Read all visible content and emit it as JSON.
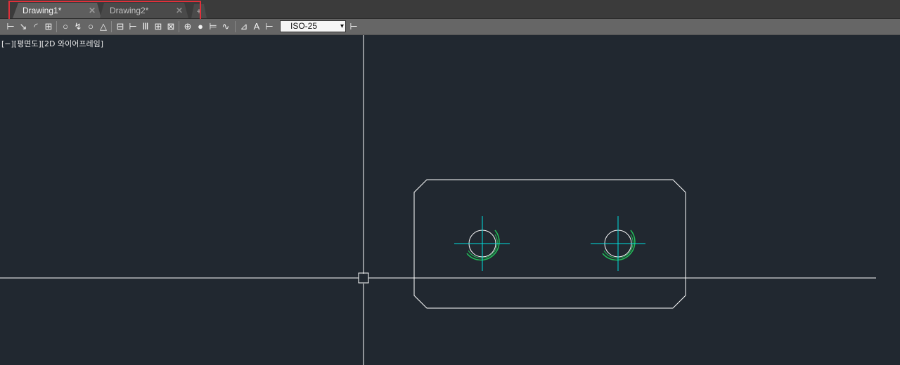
{
  "tabs": [
    {
      "label": "Drawing1*",
      "close": "✕",
      "active": true
    },
    {
      "label": "Drawing2*",
      "close": "✕",
      "active": false
    }
  ],
  "new_tab": "+",
  "toolbar": {
    "icons": [
      "dim-linear-icon",
      "dim-aligned-icon",
      "dim-arc-length-icon",
      "dim-ordinate-icon",
      "dim-radius-icon",
      "dim-jogged-icon",
      "dim-diameter-icon",
      "dim-angular-icon",
      "quick-dim-icon",
      "dim-baseline-icon",
      "dim-continue-icon",
      "dim-space-icon",
      "dim-break-icon",
      "tolerance-icon",
      "center-mark-icon",
      "inspection-icon",
      "jogged-linear-icon",
      "dim-edit-icon",
      "dim-text-edit-icon",
      "dim-update-icon"
    ],
    "dimstyle": {
      "value": "ISO-25",
      "arrow": "▾"
    },
    "dimstyle_icon": "dim-style-icon"
  },
  "viewport": {
    "label": "[−][평면도][2D 와이어프레임]"
  },
  "colors": {
    "background": "#212830",
    "geometry": "#ffffff",
    "centerline": "#00e0e0",
    "arc": "#22c05a",
    "highlight": "#e0303a"
  }
}
